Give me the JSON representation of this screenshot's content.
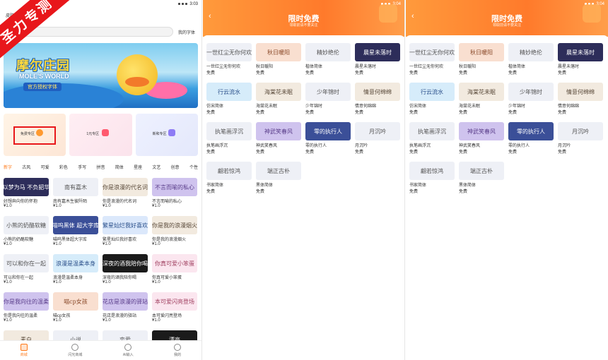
{
  "left_panel": {
    "status_time": "3:03",
    "page_title": "皮肤",
    "my_fonts_label": "我的字体",
    "watermark": "圣力专测",
    "banner": {
      "logo_text": "摩尔庄园",
      "logo_en": "MOLE'S WORLD",
      "subtitle": "官方授权字体"
    },
    "categories": [
      {
        "label": "免费专区"
      },
      {
        "label": "1元专区"
      },
      {
        "label": "新和专区"
      }
    ],
    "tabs": [
      "新字",
      "古风",
      "可爱",
      "彩色",
      "手写",
      "拼音",
      "简体",
      "星座",
      "文艺",
      "创意",
      "个性"
    ],
    "active_tab_index": 0,
    "fonts": [
      {
        "preview": "以梦为马 不负韶华",
        "name": "好想奔向你的怀抱",
        "price": "¥1.0",
        "style": "pv-dark"
      },
      {
        "preview": "南有嘉木",
        "name": "南有嘉木生彼阡陌",
        "price": "¥1.0",
        "style": "pv-light"
      },
      {
        "preview": "你是浪漫的代名词",
        "name": "你是浪漫的代名词",
        "price": "¥1.0",
        "style": "pv-beige"
      },
      {
        "preview": "不言而喻的私心",
        "name": "不言而喻的私心",
        "price": "¥1.0",
        "style": "pv-purple"
      },
      {
        "preview": "小熊的奶酪软糖",
        "name": "小熊的奶酪软糖",
        "price": "¥1.0",
        "style": "pv-light"
      },
      {
        "preview": "喵呜黑体 超大字库",
        "name": "喵呜黑体超大字库",
        "price": "¥1.0",
        "style": "pv-navy"
      },
      {
        "preview": "繁星灿烂我好喜欢",
        "name": "繁星灿烂我好喜欢",
        "price": "¥1.0",
        "style": "pv-blue"
      },
      {
        "preview": "你是我的浪漫烟火",
        "name": "你是我的浪漫烟火",
        "price": "¥1.0",
        "style": "pv-beige"
      },
      {
        "preview": "可以和你在一起",
        "name": "可以和你在一起",
        "price": "¥1.0",
        "style": "pv-light"
      },
      {
        "preview": "浪漫是温柔本身",
        "name": "浪漫是温柔本身",
        "price": "¥1.0",
        "style": "pv-sky"
      },
      {
        "preview": "深夜的酒我陪你喝",
        "name": "深夜的酒我陪你喝",
        "price": "¥1.0",
        "style": "pv-black"
      },
      {
        "preview": "你真可爱小笨蛋",
        "name": "你真可爱小笨蛋",
        "price": "¥1.0",
        "style": "pv-pink"
      },
      {
        "preview": "你是我向往的温柔",
        "name": "你是我向往的温柔",
        "price": "¥1.0",
        "style": "pv-purple"
      },
      {
        "preview": "喵cp女孩",
        "name": "喵cp女孩",
        "price": "¥1.0",
        "style": "pv-peach"
      },
      {
        "preview": "花店是浪漫的驿站",
        "name": "花店是浪漫的驿站",
        "price": "¥1.0",
        "style": "pv-purple"
      },
      {
        "preview": "本可爱闪亮登场",
        "name": "本可爱闪亮登场",
        "price": "¥1.0",
        "style": "pv-pink"
      },
      {
        "preview": "素白",
        "name": "",
        "price": "",
        "style": "pv-beige"
      },
      {
        "preview": "小说",
        "name": "",
        "price": "",
        "style": "pv-light"
      },
      {
        "preview": "恋爱",
        "name": "",
        "price": "",
        "style": "pv-light"
      },
      {
        "preview": "漂亮",
        "name": "",
        "price": "",
        "style": "pv-black"
      }
    ],
    "bottom_nav": [
      {
        "label": "商城",
        "active": true
      },
      {
        "label": "闪光商城",
        "active": false
      },
      {
        "label": "AI输入",
        "active": false
      },
      {
        "label": "我的",
        "active": false
      }
    ]
  },
  "free_panel": {
    "status_time": "3:04",
    "title": "限时免费",
    "subtitle": "领取前请不要关注",
    "fonts": [
      {
        "preview": "一世红尘无你何欢",
        "name": "一世红尘无你何欢",
        "price": "免费",
        "style": "pv-light"
      },
      {
        "preview": "秋日暖阳",
        "name": "秋日暖阳",
        "price": "免费",
        "style": "pv-peach"
      },
      {
        "preview": "精妙绝伦",
        "name": "楷体简体",
        "price": "免费",
        "style": "pv-light"
      },
      {
        "preview": "晨星未落时",
        "name": "晨星未落时",
        "price": "免费",
        "style": "pv-dark"
      },
      {
        "preview": "行云流水",
        "name": "仿宋简体",
        "price": "免费",
        "style": "pv-sky"
      },
      {
        "preview": "海棠花未眠",
        "name": "海棠花未眠",
        "price": "免费",
        "style": "pv-beige"
      },
      {
        "preview": "少年锦时",
        "name": "少年锦时",
        "price": "免费",
        "style": "pv-light"
      },
      {
        "preview": "情意何绵绵",
        "name": "情意何绵绵",
        "price": "免费",
        "style": "pv-beige"
      },
      {
        "preview": "执笔画浮沉",
        "name": "执笔画浮沉",
        "price": "免费",
        "style": "pv-light"
      },
      {
        "preview": "神武笑春风",
        "name": "神武笑春风",
        "price": "免费",
        "style": "pv-purple"
      },
      {
        "preview": "零的执行人",
        "name": "零的执行人",
        "price": "免费",
        "style": "pv-navy"
      },
      {
        "preview": "月沉吟",
        "name": "月沉吟",
        "price": "免费",
        "style": "pv-light"
      },
      {
        "preview": "翩若惊鸿",
        "name": "书家简体",
        "price": "免费",
        "style": "pv-light"
      },
      {
        "preview": "端正古朴",
        "name": "黑体简体",
        "price": "免费",
        "style": "pv-light"
      }
    ]
  },
  "free_panel_copy": {
    "status_time": "3:04",
    "title": "限时免费",
    "subtitle": "领取前请不要关注",
    "fonts": [
      {
        "preview": "一世红尘无你何欢",
        "name": "一世红尘无你何欢",
        "price": "免费",
        "style": "pv-light"
      },
      {
        "preview": "秋日暖阳",
        "name": "秋日暖阳",
        "price": "免费",
        "style": "pv-peach"
      },
      {
        "preview": "精妙绝伦",
        "name": "楷体简体",
        "price": "免费",
        "style": "pv-light"
      },
      {
        "preview": "晨星未落时",
        "name": "晨星未落时",
        "price": "免费",
        "style": "pv-dark"
      },
      {
        "preview": "行云流水",
        "name": "仿宋简体",
        "price": "免费",
        "style": "pv-sky"
      },
      {
        "preview": "海棠花未眠",
        "name": "海棠花未眠",
        "price": "免费",
        "style": "pv-beige"
      },
      {
        "preview": "少年锦时",
        "name": "少年锦时",
        "price": "免费",
        "style": "pv-light"
      },
      {
        "preview": "情意何绵绵",
        "name": "情意何绵绵",
        "price": "免费",
        "style": "pv-beige"
      },
      {
        "preview": "执笔画浮沉",
        "name": "执笔画浮沉",
        "price": "免费",
        "style": "pv-light"
      },
      {
        "preview": "神武笑春风",
        "name": "神武笑春风",
        "price": "免费",
        "style": "pv-purple"
      },
      {
        "preview": "零的执行人",
        "name": "零的执行人",
        "price": "免费",
        "style": "pv-navy"
      },
      {
        "preview": "月沉吟",
        "name": "月沉吟",
        "price": "免费",
        "style": "pv-light"
      },
      {
        "preview": "翩若惊鸿",
        "name": "书家简体",
        "price": "免费",
        "style": "pv-light"
      },
      {
        "preview": "端正古朴",
        "name": "黑体简体",
        "price": "免费",
        "style": "pv-light"
      }
    ]
  },
  "colors": {
    "accent_orange": "#ff7a1a",
    "header_orange": "#ff8a30",
    "watermark_red": "#e8171b"
  }
}
